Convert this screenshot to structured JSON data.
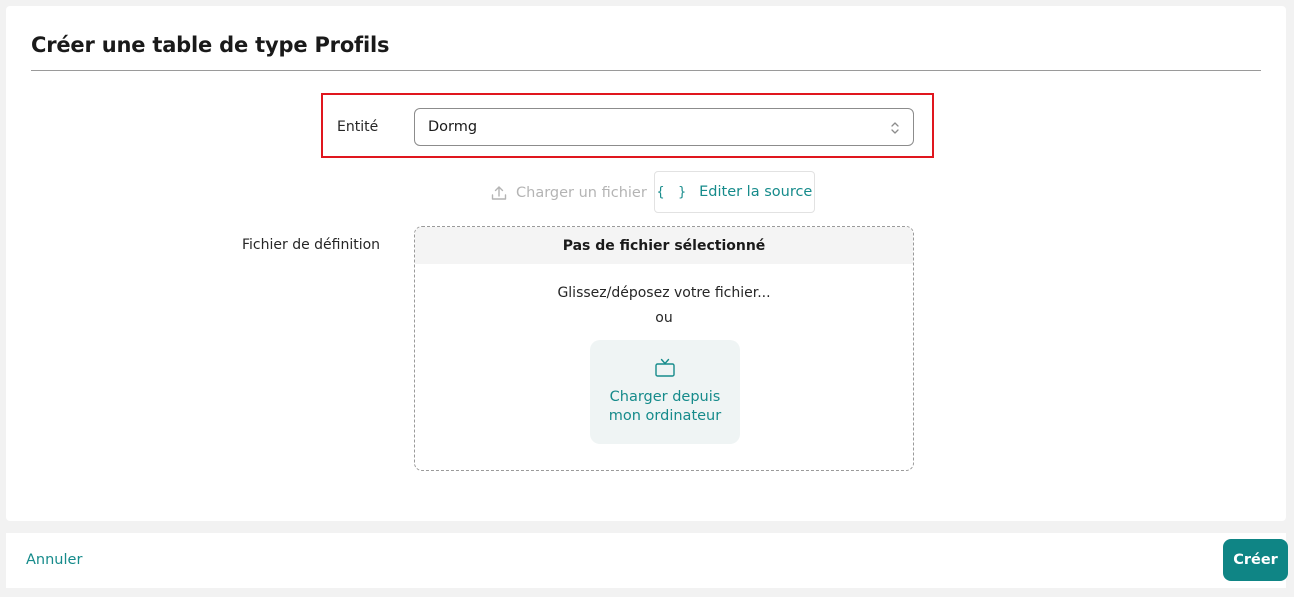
{
  "header": {
    "title": "Créer une table de type Profils"
  },
  "form": {
    "entity": {
      "label": "Entité",
      "value": "Dormg"
    },
    "source_switch": {
      "upload_label": "Charger un fichier",
      "edit_label": "Editer la source",
      "edit_icon": "{ }"
    },
    "definition_file": {
      "label": "Fichier de définition",
      "status": "Pas de fichier sélectionné",
      "drop_hint": "Glissez/déposez votre fichier...",
      "or_label": "ou",
      "computer_button_label": "Charger depuis\nmon ordinateur"
    }
  },
  "footer": {
    "cancel_label": "Annuler",
    "create_label": "Créer"
  },
  "colors": {
    "accent": "#168b8b",
    "primary_button": "#0f8585",
    "highlight": "#e0161e"
  }
}
